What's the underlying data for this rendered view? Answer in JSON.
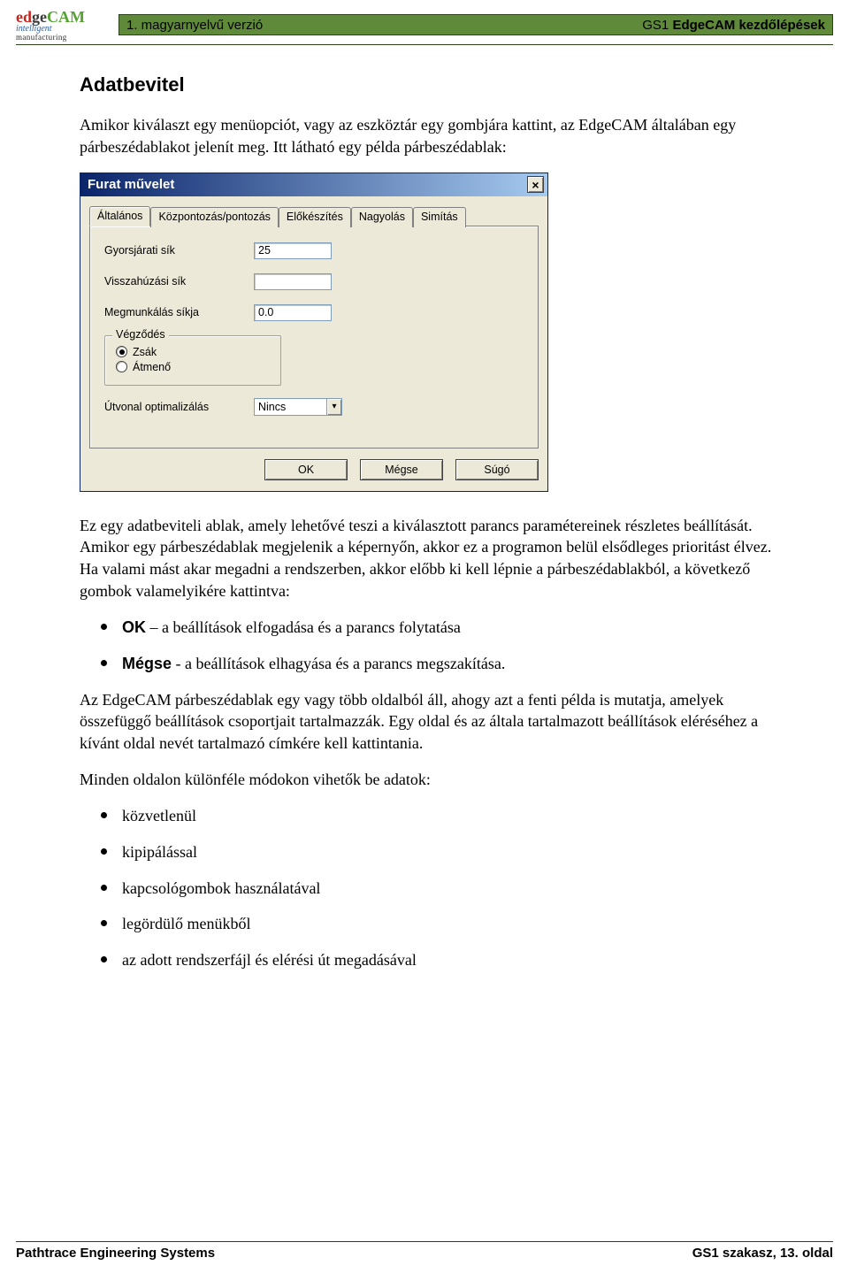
{
  "header": {
    "logo": {
      "line1": "edgeCAM",
      "line2": "intelligent",
      "line3": "manufacturing"
    },
    "left_text": "1. magyarnyelvű verzió",
    "right_prefix": "GS1 ",
    "right_bold": "EdgeCAM kezdőlépések"
  },
  "doc": {
    "title": "Adatbevitel",
    "p1": "Amikor kiválaszt egy menüopciót, vagy az eszköztár egy gombjára kattint, az EdgeCAM általában egy párbeszédablakot jelenít meg. Itt látható egy példa párbeszédablak:",
    "p2": "Ez egy adatbeviteli ablak, amely lehetővé teszi a kiválasztott parancs paramétereinek részletes beállítását. Amikor egy párbeszédablak megjelenik a képernyőn, akkor ez a programon belül elsődleges prioritást élvez. Ha valami mást akar megadni a rendszerben, akkor előbb ki kell lépnie a párbeszédablakból, a következő gombok valamelyikére kattintva:",
    "bullets1": [
      {
        "bold": "OK",
        "rest": " – a beállítások elfogadása és a parancs folytatása"
      },
      {
        "bold": "Mégse",
        "rest": " - a beállítások elhagyása és a parancs megszakítása."
      }
    ],
    "p3": "Az EdgeCAM párbeszédablak egy vagy több oldalból áll, ahogy azt a fenti példa is mutatja, amelyek összefüggő beállítások csoportjait tartalmazzák. Egy oldal és az általa tartalmazott beállítások eléréséhez a kívánt oldal nevét tartalmazó címkére kell kattintania.",
    "p4": "Minden oldalon különféle módokon vihetők be adatok:",
    "bullets2": [
      "közvetlenül",
      "kipipálással",
      "kapcsológombok használatával",
      "legördülő menükből",
      "az adott rendszerfájl és elérési út megadásával"
    ]
  },
  "dialog": {
    "title": "Furat művelet",
    "tabs": [
      "Általános",
      "Központozás/pontozás",
      "Előkészítés",
      "Nagyolás",
      "Simítás"
    ],
    "fields": {
      "rapid": {
        "label": "Gyorsjárati sík",
        "value": "25"
      },
      "retract": {
        "label": "Visszahúzási sík",
        "value": ""
      },
      "workplane": {
        "label": "Megmunkálás síkja",
        "value": "0.0"
      }
    },
    "fieldset": {
      "legend": "Végződés",
      "opt_blind": "Zsák",
      "opt_through": "Átmenő"
    },
    "pathopt": {
      "label": "Útvonal optimalizálás",
      "value": "Nincs"
    },
    "buttons": {
      "ok": "OK",
      "cancel": "Mégse",
      "help": "Súgó"
    }
  },
  "footer": {
    "left": "Pathtrace Engineering Systems",
    "right": "GS1 szakasz, 13. oldal"
  }
}
